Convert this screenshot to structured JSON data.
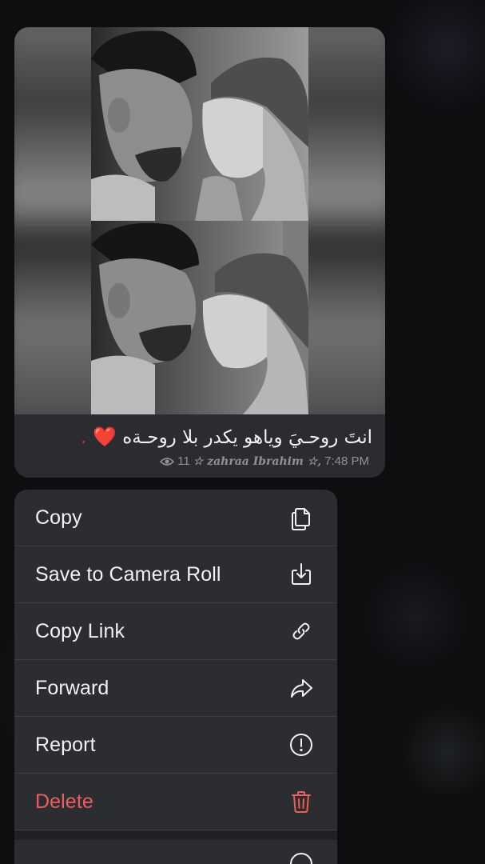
{
  "message": {
    "caption": "انتَ روحـيَ وياهو يكدر بلا روحـةه",
    "caption_heart": "❤️ .",
    "views": "11",
    "author": "☆ zahraa Ibrahim ☆,",
    "time": "7:48 PM"
  },
  "menu": {
    "items": [
      {
        "label": "Copy",
        "icon": "copy-icon"
      },
      {
        "label": "Save to Camera Roll",
        "icon": "save-download-icon"
      },
      {
        "label": "Copy Link",
        "icon": "link-icon"
      },
      {
        "label": "Forward",
        "icon": "forward-arrow-icon"
      },
      {
        "label": "Report",
        "icon": "exclamation-circle-icon"
      },
      {
        "label": "Delete",
        "icon": "trash-icon"
      }
    ]
  },
  "colors": {
    "menu_background": "#2b2d30",
    "bubble_background": "#2a2c2f",
    "delete_red": "#eb5e5f",
    "meta_gray": "#8f9296"
  }
}
